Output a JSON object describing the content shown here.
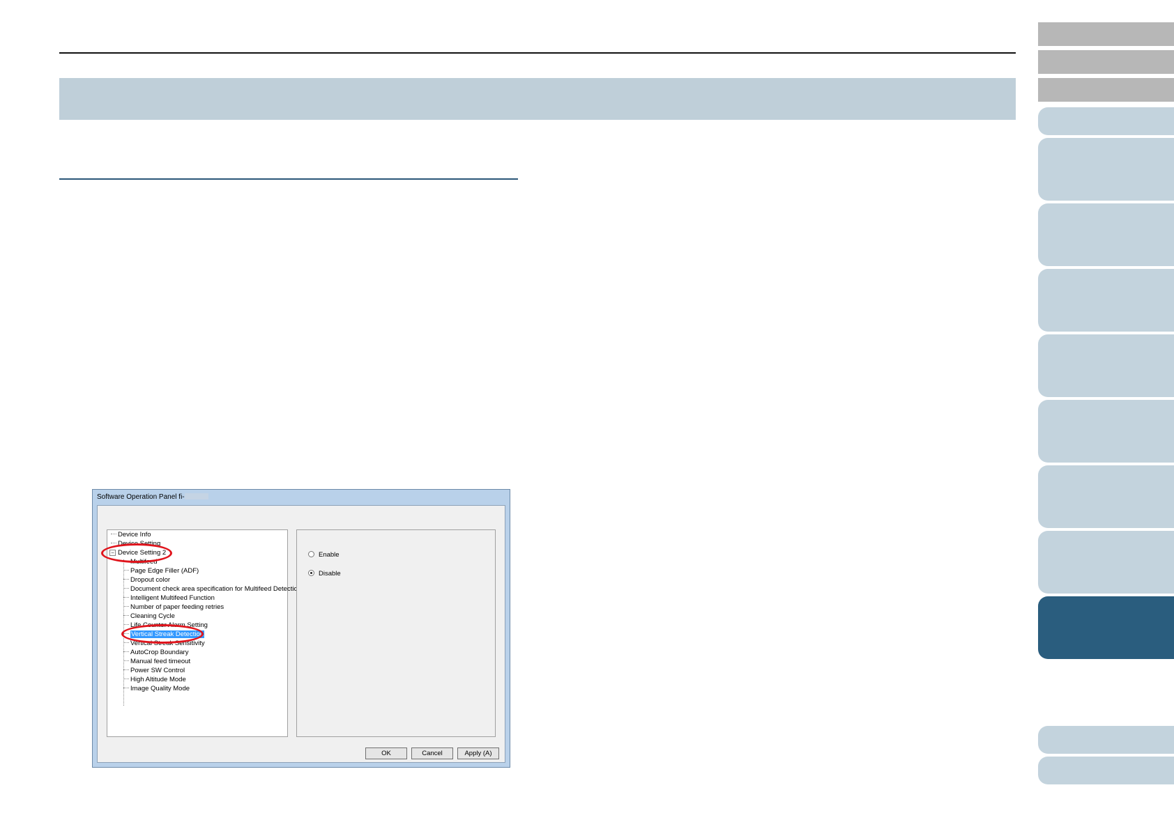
{
  "dialog": {
    "title": "Software Operation Panel fi-",
    "tree": {
      "items": [
        "Device Info",
        "Device Setting",
        "Device Setting 2",
        "Multifeed",
        "Page Edge Filler (ADF)",
        "Dropout color",
        "Document check area specification for Multifeed Detection",
        "Intelligent Multifeed Function",
        "Number of paper feeding retries",
        "Cleaning Cycle",
        "Life Counter Alarm Setting",
        "Vertical Streak Detection",
        "Vertical Streak Sensitivity",
        "AutoCrop Boundary",
        "Manual feed timeout",
        "Power SW Control",
        "High Altitude Mode",
        "Image Quality Mode"
      ],
      "expander_symbol": "−",
      "selected_item": "Vertical Streak Detection"
    },
    "options": {
      "enable_label": "Enable",
      "disable_label": "Disable",
      "selected": "Disable"
    },
    "buttons": {
      "ok": "OK",
      "cancel": "Cancel",
      "apply": "Apply (A)"
    }
  },
  "colors": {
    "heading_band": "#bfcfd9",
    "tab_gray": "#b7b7b7",
    "tab_light": "#c3d3dd",
    "tab_active": "#2a5d7e",
    "highlight": "#e0141c",
    "selection": "#3399ff"
  }
}
